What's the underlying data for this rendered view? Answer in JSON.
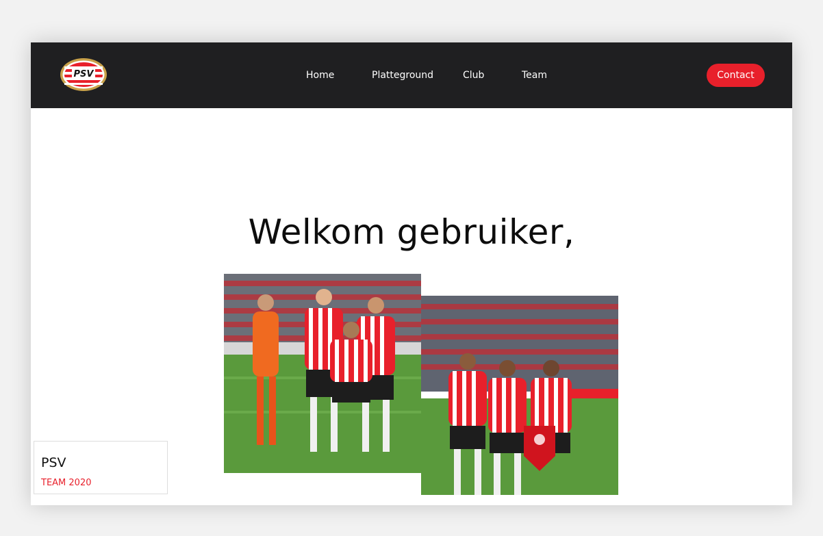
{
  "logo": {
    "text": "PSV",
    "icon": "psv-crest-logo"
  },
  "nav": {
    "items": [
      {
        "label": "Home"
      },
      {
        "label": "Platteground"
      },
      {
        "label": "Club"
      },
      {
        "label": "Team"
      }
    ],
    "contact_label": "Contact"
  },
  "hero": {
    "title": "Welkom gebruiker,"
  },
  "card": {
    "title": "PSV",
    "subtitle": "TEAM 2020"
  },
  "colors": {
    "accent": "#e8202b",
    "navbar": "#1f1f21",
    "background": "#ffffff"
  }
}
